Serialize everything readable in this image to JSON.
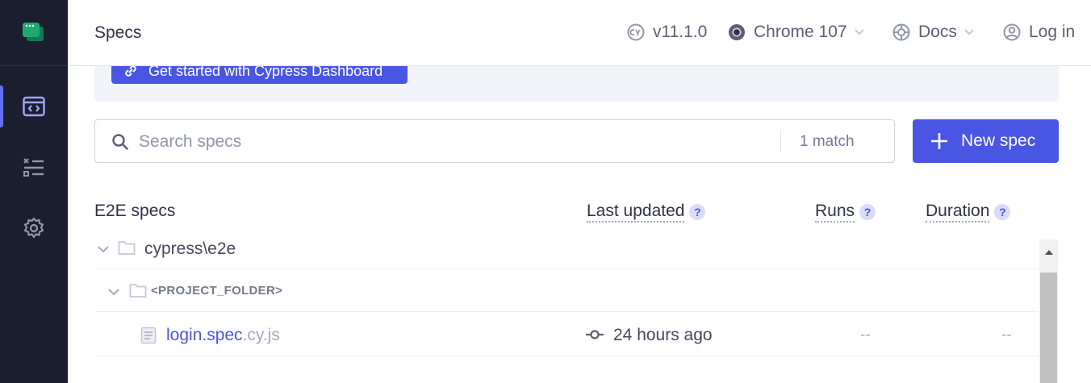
{
  "header": {
    "title": "Specs",
    "version": "v11.1.0",
    "browser": "Chrome 107",
    "docs": "Docs",
    "login": "Log in"
  },
  "banner": {
    "button_label": "Get started with Cypress Dashboard"
  },
  "search": {
    "placeholder": "Search specs",
    "match_count": "1 match"
  },
  "new_spec_label": "New spec",
  "table": {
    "title": "E2E specs",
    "columns": {
      "last_updated": "Last updated",
      "runs": "Runs",
      "duration": "Duration"
    },
    "help_badge": "?",
    "folders": [
      {
        "name": "cypress\\e2e"
      },
      {
        "name": "<PROJECT_FOLDER>"
      }
    ],
    "files": [
      {
        "name": "login.spec",
        "ext": ".cy.js",
        "last_updated": "24 hours ago",
        "runs": "--",
        "duration": "--"
      }
    ]
  },
  "colors": {
    "sidebar_bg": "#1b1e2e",
    "accent": "#4956e3",
    "logo_green": "#1fa971"
  },
  "icons": {
    "sidebar": [
      "cypress-logo-icon",
      "specs-icon",
      "runs-list-icon",
      "settings-gear-icon"
    ],
    "header": [
      "cypress-version-icon",
      "chrome-icon",
      "docs-lifebuoy-icon",
      "user-circle-icon"
    ]
  }
}
